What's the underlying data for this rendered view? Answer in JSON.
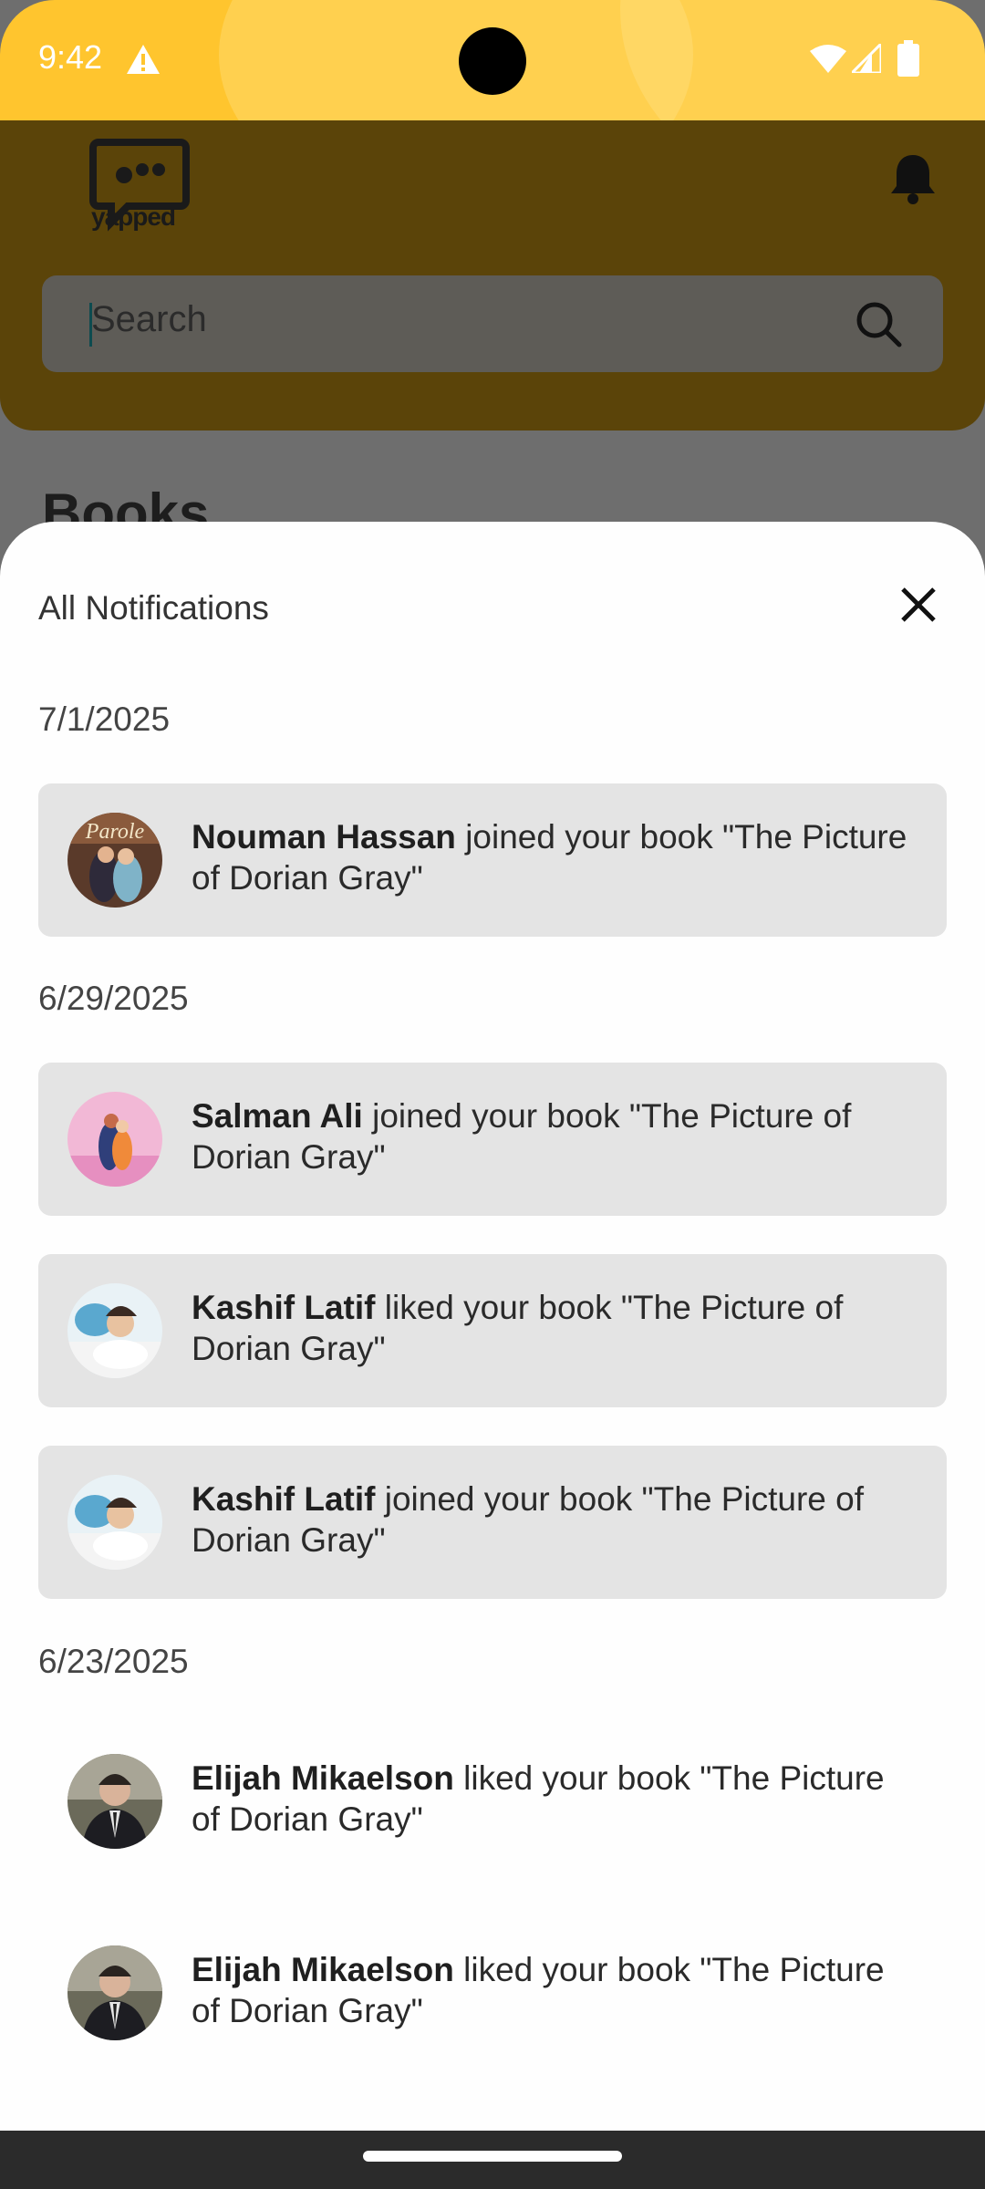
{
  "status_bar": {
    "time": "9:42",
    "icons": [
      "warning-icon",
      "wifi-icon",
      "signal-icon",
      "battery-icon"
    ]
  },
  "app": {
    "logo_text": "yapped",
    "search": {
      "placeholder": "Search"
    },
    "section_title": "Books"
  },
  "colors": {
    "accent": "#ffc52e",
    "card": "#e4e4e4",
    "sheet": "#fefefe"
  },
  "sheet": {
    "title": "All Notifications",
    "groups": [
      {
        "date": "7/1/2025",
        "items": [
          {
            "name": "Nouman Hassan",
            "text": " joined your book \"The Picture of Dorian Gray\"",
            "avatar": "book-cover-parole"
          }
        ]
      },
      {
        "date": "6/29/2025",
        "items": [
          {
            "name": "Salman Ali",
            "text": " joined your book \"The Picture of Dorian Gray\"",
            "avatar": "illustration-couple"
          },
          {
            "name": "Kashif Latif",
            "text": " liked your book \"The Picture of Dorian Gray\"",
            "avatar": "photo-dentist"
          },
          {
            "name": "Kashif Latif",
            "text": " joined your book \"The Picture of Dorian Gray\"",
            "avatar": "photo-dentist"
          }
        ]
      },
      {
        "date": "6/23/2025",
        "items": [
          {
            "name": "Elijah Mikaelson",
            "text": " liked your book \"The Picture of Dorian Gray\"",
            "avatar": "photo-man-suit"
          },
          {
            "name": "Elijah Mikaelson",
            "text": " liked your book \"The Picture of Dorian Gray\"",
            "avatar": "photo-man-suit"
          }
        ]
      }
    ]
  }
}
